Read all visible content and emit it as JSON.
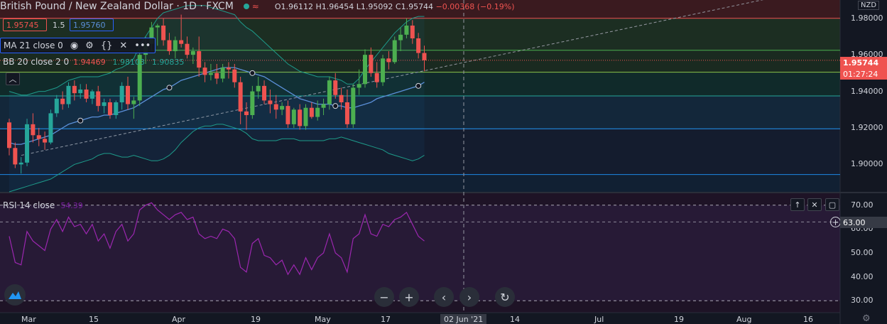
{
  "header": {
    "title": "British Pound / New Zealand Dollar · 1D · FXCM",
    "ohlc": {
      "o": "O1.96112",
      "h": "H1.96454",
      "l": "L1.95092",
      "c": "C1.95744",
      "chg": "−0.00368 (−0.19%)"
    },
    "currency": "NZD"
  },
  "trade": {
    "sell": "1.95745",
    "spread": "1.5",
    "buy": "1.95760"
  },
  "indicators": {
    "ma": {
      "label": "MA 21 close 0"
    },
    "bb": {
      "label": "BB 20 close 2 0",
      "v1": "1.94469",
      "v2": "1.98103",
      "v3": "1.90835"
    },
    "rsi": {
      "label": "RSI 14 close",
      "value": "54.39"
    }
  },
  "price_axis": {
    "ticks": [
      "1.98000",
      "1.96000",
      "1.94000",
      "1.92000",
      "1.90000"
    ],
    "last_price": "1.95744",
    "countdown": "01:27:24"
  },
  "rsi_axis": {
    "ticks": [
      "70.00",
      "60.00",
      "50.00",
      "40.00",
      "30.00"
    ],
    "cursor": "63.00"
  },
  "time_axis": {
    "ticks": [
      "Mar",
      "15",
      "Apr",
      "19",
      "May",
      "17",
      "14",
      "Jul",
      "19",
      "Aug",
      "16"
    ],
    "cursor": "02 Jun '21"
  },
  "colors": {
    "up": "#26a69a",
    "down": "#ef5350",
    "up_bright": "#4caf50",
    "ma": "#5b8fd8",
    "bb": "#1e9b8a",
    "rsi": "#9c27b0"
  },
  "chart_data": {
    "type": "candlestick",
    "symbol": "GBPNZD",
    "interval": "1D",
    "ylim": [
      1.885,
      1.99
    ],
    "candles": [
      [
        1.923,
        1.925,
        1.905,
        1.909
      ],
      [
        1.909,
        1.912,
        1.898,
        1.9
      ],
      [
        1.9,
        1.904,
        1.895,
        1.901
      ],
      [
        1.901,
        1.925,
        1.899,
        1.922
      ],
      [
        1.922,
        1.928,
        1.912,
        1.916
      ],
      [
        1.916,
        1.92,
        1.91,
        1.914
      ],
      [
        1.914,
        1.918,
        1.908,
        1.912
      ],
      [
        1.912,
        1.93,
        1.911,
        1.928
      ],
      [
        1.928,
        1.938,
        1.926,
        1.936
      ],
      [
        1.936,
        1.94,
        1.93,
        1.933
      ],
      [
        1.933,
        1.945,
        1.931,
        1.943
      ],
      [
        1.943,
        1.946,
        1.935,
        1.939
      ],
      [
        1.939,
        1.944,
        1.936,
        1.941
      ],
      [
        1.941,
        1.944,
        1.934,
        1.936
      ],
      [
        1.936,
        1.941,
        1.933,
        1.94
      ],
      [
        1.94,
        1.943,
        1.929,
        1.932
      ],
      [
        1.932,
        1.936,
        1.928,
        1.934
      ],
      [
        1.934,
        1.936,
        1.925,
        1.927
      ],
      [
        1.927,
        1.935,
        1.925,
        1.934
      ],
      [
        1.934,
        1.945,
        1.93,
        1.943
      ],
      [
        1.943,
        1.948,
        1.93,
        1.933
      ],
      [
        1.933,
        1.937,
        1.925,
        1.935
      ],
      [
        1.935,
        1.963,
        1.932,
        1.96
      ],
      [
        1.96,
        1.97,
        1.955,
        1.966
      ],
      [
        1.966,
        1.978,
        1.962,
        1.975
      ],
      [
        1.975,
        1.977,
        1.965,
        1.976
      ],
      [
        1.976,
        1.98,
        1.965,
        1.968
      ],
      [
        1.968,
        1.972,
        1.96,
        1.962
      ],
      [
        1.962,
        1.97,
        1.958,
        1.968
      ],
      [
        1.968,
        1.982,
        1.964,
        1.966
      ],
      [
        1.966,
        1.97,
        1.958,
        1.96
      ],
      [
        1.96,
        1.964,
        1.955,
        1.962
      ],
      [
        1.962,
        1.97,
        1.948,
        1.953
      ],
      [
        1.953,
        1.956,
        1.945,
        1.949
      ],
      [
        1.949,
        1.955,
        1.946,
        1.95
      ],
      [
        1.95,
        1.955,
        1.944,
        1.947
      ],
      [
        1.947,
        1.955,
        1.945,
        1.953
      ],
      [
        1.953,
        1.956,
        1.947,
        1.952
      ],
      [
        1.952,
        1.955,
        1.942,
        1.945
      ],
      [
        1.945,
        1.948,
        1.922,
        1.929
      ],
      [
        1.929,
        1.934,
        1.919,
        1.927
      ],
      [
        1.927,
        1.943,
        1.925,
        1.94
      ],
      [
        1.94,
        1.948,
        1.936,
        1.943
      ],
      [
        1.943,
        1.946,
        1.933,
        1.935
      ],
      [
        1.935,
        1.941,
        1.928,
        1.933
      ],
      [
        1.933,
        1.938,
        1.925,
        1.93
      ],
      [
        1.93,
        1.934,
        1.927,
        1.932
      ],
      [
        1.932,
        1.935,
        1.92,
        1.922
      ],
      [
        1.922,
        1.931,
        1.92,
        1.93
      ],
      [
        1.93,
        1.933,
        1.919,
        1.921
      ],
      [
        1.921,
        1.933,
        1.919,
        1.931
      ],
      [
        1.931,
        1.934,
        1.925,
        1.926
      ],
      [
        1.926,
        1.935,
        1.924,
        1.931
      ],
      [
        1.931,
        1.936,
        1.927,
        1.933
      ],
      [
        1.933,
        1.948,
        1.93,
        1.946
      ],
      [
        1.946,
        1.95,
        1.936,
        1.938
      ],
      [
        1.938,
        1.942,
        1.93,
        1.934
      ],
      [
        1.934,
        1.941,
        1.92,
        1.922
      ],
      [
        1.922,
        1.944,
        1.92,
        1.942
      ],
      [
        1.942,
        1.952,
        1.938,
        1.944
      ],
      [
        1.944,
        1.963,
        1.942,
        1.96
      ],
      [
        1.96,
        1.964,
        1.948,
        1.95
      ],
      [
        1.95,
        1.956,
        1.942,
        1.945
      ],
      [
        1.945,
        1.96,
        1.943,
        1.958
      ],
      [
        1.958,
        1.962,
        1.952,
        1.956
      ],
      [
        1.956,
        1.97,
        1.955,
        1.968
      ],
      [
        1.968,
        1.975,
        1.962,
        1.971
      ],
      [
        1.971,
        1.98,
        1.969,
        1.976
      ],
      [
        1.976,
        1.979,
        1.966,
        1.969
      ],
      [
        1.969,
        1.972,
        1.958,
        1.961
      ],
      [
        1.961,
        1.965,
        1.951,
        1.957
      ]
    ],
    "ma21": [
      1.912,
      1.911,
      1.911,
      1.912,
      1.913,
      1.914,
      1.915,
      1.916,
      1.918,
      1.92,
      1.922,
      1.923,
      1.924,
      1.925,
      1.926,
      1.926,
      1.927,
      1.927,
      1.928,
      1.929,
      1.93,
      1.931,
      1.933,
      1.935,
      1.937,
      1.939,
      1.941,
      1.942,
      1.944,
      1.946,
      1.947,
      1.948,
      1.949,
      1.95,
      1.951,
      1.952,
      1.953,
      1.953,
      1.953,
      1.952,
      1.951,
      1.95,
      1.949,
      1.948,
      1.946,
      1.944,
      1.942,
      1.94,
      1.938,
      1.936,
      1.935,
      1.934,
      1.933,
      1.933,
      1.933,
      1.932,
      1.932,
      1.931,
      1.931,
      1.932,
      1.933,
      1.934,
      1.936,
      1.937,
      1.938,
      1.939,
      1.94,
      1.941,
      1.942,
      1.943,
      1.945
    ],
    "bb_upper": [
      1.94,
      1.939,
      1.938,
      1.938,
      1.939,
      1.94,
      1.94,
      1.941,
      1.942,
      1.944,
      1.946,
      1.947,
      1.948,
      1.948,
      1.948,
      1.948,
      1.949,
      1.95,
      1.952,
      1.953,
      1.955,
      1.958,
      1.965,
      1.97,
      1.975,
      1.98,
      1.983,
      1.984,
      1.985,
      1.986,
      1.987,
      1.987,
      1.987,
      1.987,
      1.986,
      1.985,
      1.984,
      1.983,
      1.982,
      1.978,
      1.975,
      1.973,
      1.97,
      1.967,
      1.964,
      1.961,
      1.958,
      1.955,
      1.953,
      1.951,
      1.95,
      1.949,
      1.948,
      1.948,
      1.948,
      1.947,
      1.946,
      1.944,
      1.944,
      1.947,
      1.952,
      1.956,
      1.96,
      1.964,
      1.968,
      1.972,
      1.975,
      1.978,
      1.98,
      1.981,
      1.981
    ],
    "bb_lower": [
      1.885,
      1.886,
      1.887,
      1.888,
      1.889,
      1.89,
      1.891,
      1.892,
      1.894,
      1.896,
      1.898,
      1.9,
      1.901,
      1.902,
      1.903,
      1.905,
      1.906,
      1.906,
      1.905,
      1.904,
      1.904,
      1.905,
      1.904,
      1.903,
      1.902,
      1.902,
      1.903,
      1.905,
      1.908,
      1.912,
      1.915,
      1.918,
      1.92,
      1.921,
      1.921,
      1.922,
      1.922,
      1.921,
      1.92,
      1.919,
      1.917,
      1.914,
      1.913,
      1.913,
      1.913,
      1.913,
      1.914,
      1.914,
      1.914,
      1.913,
      1.913,
      1.913,
      1.913,
      1.913,
      1.914,
      1.914,
      1.915,
      1.914,
      1.913,
      1.912,
      1.911,
      1.91,
      1.909,
      1.908,
      1.906,
      1.905,
      1.904,
      1.903,
      1.902,
      1.903,
      1.905
    ],
    "rsi": [
      57,
      46,
      45,
      59,
      55,
      53,
      51,
      60,
      64,
      59,
      65,
      61,
      62,
      58,
      62,
      55,
      58,
      52,
      59,
      62,
      55,
      58,
      68,
      70,
      71,
      68,
      66,
      64,
      66,
      67,
      64,
      65,
      58,
      56,
      57,
      56,
      60,
      59,
      56,
      44,
      42,
      54,
      56,
      49,
      48,
      45,
      47,
      41,
      45,
      41,
      48,
      43,
      48,
      50,
      58,
      50,
      48,
      42,
      56,
      58,
      66,
      58,
      57,
      62,
      61,
      64,
      65,
      67,
      62,
      57,
      55
    ],
    "hlines": [
      1.98,
      1.9625,
      1.9505,
      1.9375,
      1.9195,
      1.8945
    ],
    "rsi_levels": [
      70,
      30
    ],
    "rsi_ylim": [
      25,
      75
    ]
  }
}
